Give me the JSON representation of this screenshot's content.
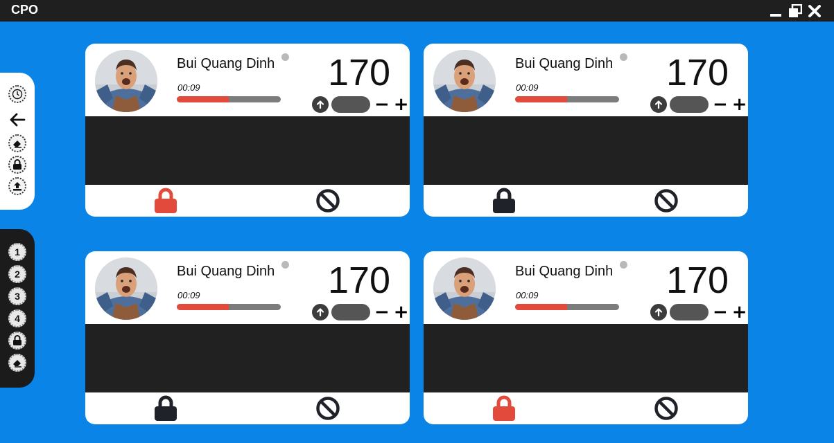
{
  "window": {
    "title": "CPO",
    "controls": [
      "minimize-icon",
      "restore-icon",
      "close-icon"
    ]
  },
  "left_toolbar": {
    "tools": [
      "clock-icon",
      "back-arrow-icon",
      "eraser-icon",
      "lock-icon",
      "upload-icon"
    ]
  },
  "number_toolbar": {
    "items": [
      "1",
      "2",
      "3",
      "4"
    ],
    "extra_tools": [
      "lock-icon",
      "eraser-icon"
    ]
  },
  "colors": {
    "accent_background": "#0a84e6",
    "lock_active": "#e24b3b",
    "lock_inactive": "#1f2329",
    "progress": "#e24b3b"
  },
  "cards": [
    {
      "name": "Bui Quang Dinh",
      "timer": "00:09",
      "progress": 0.5,
      "score": "170",
      "lock_state": "active"
    },
    {
      "name": "Bui Quang Dinh",
      "timer": "00:09",
      "progress": 0.5,
      "score": "170",
      "lock_state": "inactive"
    },
    {
      "name": "Bui Quang Dinh",
      "timer": "00:09",
      "progress": 0.5,
      "score": "170",
      "lock_state": "inactive"
    },
    {
      "name": "Bui Quang Dinh",
      "timer": "00:09",
      "progress": 0.5,
      "score": "170",
      "lock_state": "active"
    }
  ],
  "card_controls": {
    "minus": "−",
    "plus": "+"
  }
}
